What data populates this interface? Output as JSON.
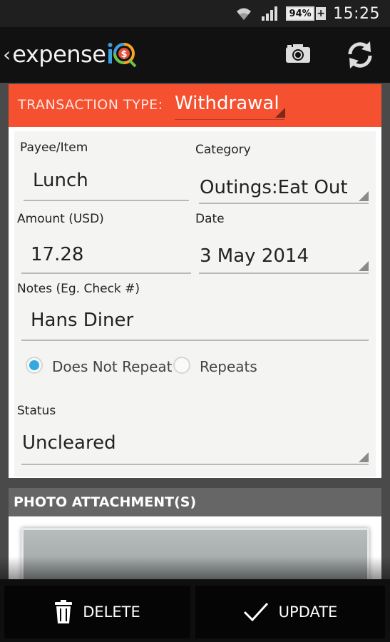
{
  "status_bar": {
    "time": "15:25",
    "battery": "94%",
    "battery_charging": "+"
  },
  "app": {
    "logo_text": "expense",
    "back_icon": "‹"
  },
  "toolbar": {
    "camera_icon": "camera-icon",
    "refresh_icon": "refresh-icon"
  },
  "transaction": {
    "type_label": "TRANSACTION TYPE:",
    "type_value": "Withdrawal"
  },
  "form": {
    "payee_label": "Payee/Item",
    "payee_value": "Lunch",
    "category_label": "Category",
    "category_value": "Outings:Eat Out",
    "amount_label": "Amount (USD)",
    "amount_value": "17.28",
    "date_label": "Date",
    "date_value": "3 May 2014",
    "notes_label": "Notes (Eg. Check #)",
    "notes_value": "Hans Diner",
    "repeat_options": [
      "Does Not Repeat",
      "Repeats"
    ],
    "repeat_selected": "Does Not Repeat",
    "status_label": "Status",
    "status_value": "Uncleared"
  },
  "photo": {
    "header": "PHOTO ATTACHMENT(S)"
  },
  "actions": {
    "delete_label": "DELETE",
    "update_label": "UPDATE"
  },
  "colors": {
    "accent": "#f5502f",
    "radio_selected": "#33a9e0"
  }
}
